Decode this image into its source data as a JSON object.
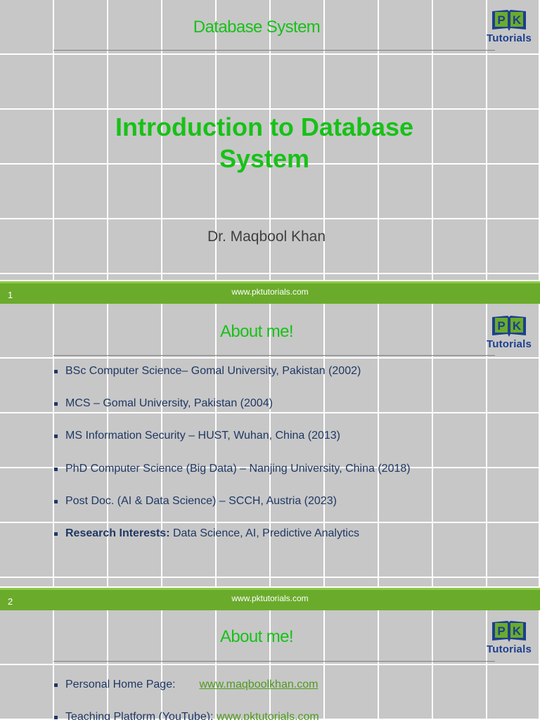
{
  "slides": [
    {
      "header": "Database System",
      "title_line1": "Introduction to Database",
      "title_line2": "System",
      "author": "Dr. Maqbool Khan",
      "footer": {
        "number": "1",
        "url": "www.pktutorials.com"
      }
    },
    {
      "header": "About me!",
      "bullets": [
        {
          "text": "BSc Computer Science– Gomal University, Pakistan (2002)"
        },
        {
          "text": "MCS – Gomal University, Pakistan (2004)"
        },
        {
          "text": "MS Information Security – HUST, Wuhan, China (2013)"
        },
        {
          "text": "PhD Computer Science (Big Data) – Nanjing University, China (2018)"
        },
        {
          "text": "Post Doc. (AI & Data Science) – SCCH, Austria (2023)"
        },
        {
          "bold": "Research Interests:",
          "text": " Data Science, AI, Predictive Analytics"
        }
      ],
      "footer": {
        "number": "2",
        "url": "www.pktutorials.com"
      }
    },
    {
      "header": "About me!",
      "links": [
        {
          "label": "Personal Home Page:",
          "url": "www.maqboolkhan.com"
        },
        {
          "label": "Teaching Platform (YouTube):",
          "url": "www.pktutorials.com"
        }
      ]
    }
  ],
  "logo": {
    "letters": "PK",
    "text": "Tutorials",
    "icon": "open-book-icon"
  },
  "colors": {
    "title_green": "#17c117",
    "footer_green": "#6aab2b",
    "logo_blue": "#1d3f8f",
    "bullet_navy": "#1f3864",
    "link_green": "#4f9a1e"
  }
}
